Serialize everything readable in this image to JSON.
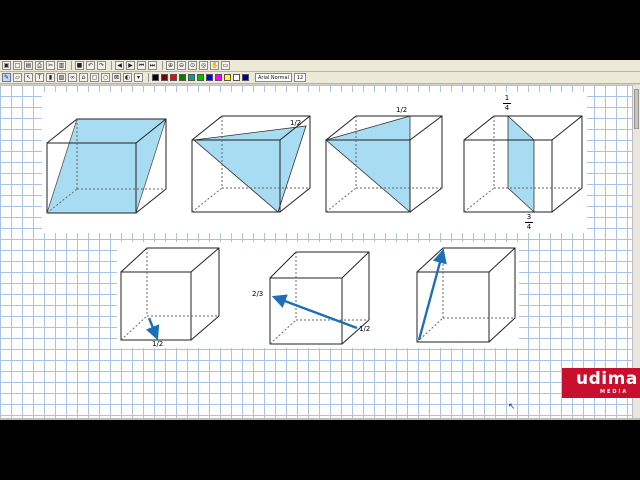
{
  "toolbar_top": {
    "buttons": [
      {
        "name": "save-icon",
        "glyph": "▣"
      },
      {
        "name": "new-icon",
        "glyph": "□"
      },
      {
        "name": "copy-icon",
        "glyph": "▤"
      },
      {
        "name": "print-icon",
        "glyph": "⎙"
      },
      {
        "name": "cut-icon",
        "glyph": "✂"
      },
      {
        "name": "paste-icon",
        "glyph": "▥"
      },
      {
        "name": "bold-icon",
        "glyph": "■"
      },
      {
        "name": "undo-icon",
        "glyph": "↶"
      },
      {
        "name": "redo-icon",
        "glyph": "↷"
      },
      {
        "name": "arrow-left-icon",
        "glyph": "◀"
      },
      {
        "name": "arrow-right-icon",
        "glyph": "▶"
      },
      {
        "name": "first-page-icon",
        "glyph": "⏮"
      },
      {
        "name": "last-page-icon",
        "glyph": "⏭"
      },
      {
        "name": "zoom-in-icon",
        "glyph": "⊕"
      },
      {
        "name": "zoom-out-icon",
        "glyph": "⊖"
      },
      {
        "name": "zoom-fit-icon",
        "glyph": "⊙"
      },
      {
        "name": "zoom-page-icon",
        "glyph": "◎"
      },
      {
        "name": "hand-icon",
        "glyph": "✋"
      },
      {
        "name": "screen-icon",
        "glyph": "▭"
      }
    ]
  },
  "toolbar_draw": {
    "tools": [
      {
        "name": "pen-icon",
        "glyph": "✎",
        "active": true
      },
      {
        "name": "eraser-icon",
        "glyph": "▱"
      },
      {
        "name": "pointer-icon",
        "glyph": "↖"
      },
      {
        "name": "text-icon",
        "glyph": "T"
      },
      {
        "name": "highlighter-icon",
        "glyph": "▮"
      },
      {
        "name": "image-icon",
        "glyph": "▨"
      },
      {
        "name": "link-icon",
        "glyph": "∞"
      },
      {
        "name": "stamp-icon",
        "glyph": "⌂"
      },
      {
        "name": "shape-icon",
        "glyph": "▢"
      },
      {
        "name": "circle-tool-icon",
        "glyph": "○"
      },
      {
        "name": "lock-icon",
        "glyph": "⊠"
      },
      {
        "name": "fill-icon",
        "glyph": "◐"
      },
      {
        "name": "dropdown-icon",
        "glyph": "▾"
      }
    ],
    "colors": [
      "#000000",
      "#800000",
      "#ff0000",
      "#008000",
      "#00a0a0",
      "#00c000",
      "#0000ff",
      "#ff00ff",
      "#ffff00",
      "#ffffff",
      "#0000a0"
    ],
    "font_name": "Arial Normal",
    "font_size": "12"
  },
  "top_figures": {
    "fig2_label": "1/2",
    "fig3_label": "1/2",
    "fig4_top_num": "1",
    "fig4_top_den": "4",
    "fig4_bottom_num": "3",
    "fig4_bottom_den": "4"
  },
  "bottom_figures": {
    "fig1_label": "1/2",
    "fig2_label_left": "2/3",
    "fig2_label_right": "1/2"
  },
  "logo": {
    "main": "udima",
    "sub": "MEDIA"
  },
  "colors": {
    "fill": "#a8dcf2",
    "vector": "#1e6fb8",
    "grid": "#a9c3e6",
    "logo": "#c8102e"
  }
}
